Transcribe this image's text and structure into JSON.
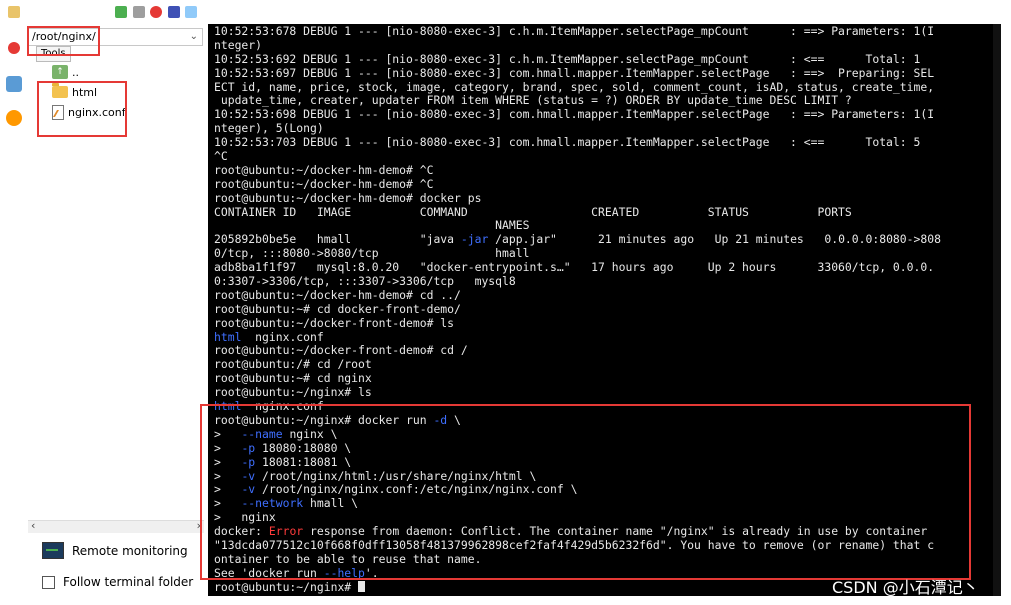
{
  "file_panel": {
    "path": "/root/nginx/",
    "tooltip": "Tools",
    "tree": [
      {
        "name": "..",
        "icon": "up-folder-icon"
      },
      {
        "name": "html",
        "icon": "folder-icon"
      },
      {
        "name": "nginx.conf",
        "icon": "file-icon"
      }
    ],
    "remote_monitoring": "Remote monitoring",
    "follow_terminal_folder": "Follow terminal folder"
  },
  "terminal": {
    "lines": [
      [
        {
          "t": "10:52:53:678 DEBUG 1 --- [nio-8080-exec-3] c.h.m.ItemMapper.selectPage_mpCount      : ==> Parameters: 1(I"
        }
      ],
      [
        {
          "t": "nteger)"
        }
      ],
      [
        {
          "t": "10:52:53:692 DEBUG 1 --- [nio-8080-exec-3] c.h.m.ItemMapper.selectPage_mpCount      : <==      Total: 1"
        }
      ],
      [
        {
          "t": "10:52:53:697 DEBUG 1 --- [nio-8080-exec-3] com.hmall.mapper.ItemMapper.selectPage   : ==>  Preparing: SEL"
        }
      ],
      [
        {
          "t": "ECT id, name, price, stock, image, category, brand, spec, sold, comment_count, isAD, status, create_time,"
        }
      ],
      [
        {
          "t": " update_time, creater, updater FROM item WHERE (status = ?) ORDER BY update_time DESC LIMIT ?"
        }
      ],
      [
        {
          "t": "10:52:53:698 DEBUG 1 --- [nio-8080-exec-3] com.hmall.mapper.ItemMapper.selectPage   : ==> Parameters: 1(I"
        }
      ],
      [
        {
          "t": "nteger), 5(Long)"
        }
      ],
      [
        {
          "t": "10:52:53:703 DEBUG 1 --- [nio-8080-exec-3] com.hmall.mapper.ItemMapper.selectPage   : <==      Total: 5"
        }
      ],
      [
        {
          "t": "^C"
        }
      ],
      [
        {
          "t": "root@ubuntu:~/docker-hm-demo# ^C"
        }
      ],
      [
        {
          "t": "root@ubuntu:~/docker-hm-demo# ^C"
        }
      ],
      [
        {
          "t": "root@ubuntu:~/docker-hm-demo# docker ps"
        }
      ],
      [
        {
          "t": "CONTAINER ID   IMAGE          COMMAND                  CREATED          STATUS          PORTS"
        }
      ],
      [
        {
          "t": "                                         NAMES"
        }
      ],
      [
        {
          "t": "205892b0be5e   hmall          \"java "
        },
        {
          "t": "-jar",
          "c": "blue"
        },
        {
          "t": " /app.jar\"      21 minutes ago   Up 21 minutes   0.0.0.0:8080->808"
        }
      ],
      [
        {
          "t": "0/tcp, :::8080->8080/tcp                 hmall"
        }
      ],
      [
        {
          "t": "adb8ba1f1f97   mysql:8.0.20   \"docker-entrypoint.s…\"   17 hours ago     Up 2 hours      33060/tcp, 0.0.0."
        }
      ],
      [
        {
          "t": "0:3307->3306/tcp, :::3307->3306/tcp   mysql8"
        }
      ],
      [
        {
          "t": "root@ubuntu:~/docker-hm-demo# cd ../"
        }
      ],
      [
        {
          "t": "root@ubuntu:~# cd docker-front-demo/"
        }
      ],
      [
        {
          "t": "root@ubuntu:~/docker-front-demo# ls"
        }
      ],
      [
        {
          "t": "html",
          "c": "blue"
        },
        {
          "t": "  nginx.conf"
        }
      ],
      [
        {
          "t": "root@ubuntu:~/docker-front-demo# cd /"
        }
      ],
      [
        {
          "t": "root@ubuntu:/# cd /root"
        }
      ],
      [
        {
          "t": "root@ubuntu:~# cd nginx"
        }
      ],
      [
        {
          "t": "root@ubuntu:~/nginx# ls"
        }
      ],
      [
        {
          "t": "html",
          "c": "blue"
        },
        {
          "t": "  nginx.conf"
        }
      ],
      [
        {
          "t": "root@ubuntu:~/nginx# docker run "
        },
        {
          "t": "-d",
          "c": "blue"
        },
        {
          "t": " \\"
        }
      ],
      [
        {
          "t": ">   "
        },
        {
          "t": "--name",
          "c": "blue"
        },
        {
          "t": " nginx \\"
        }
      ],
      [
        {
          "t": ">   "
        },
        {
          "t": "-p",
          "c": "blue"
        },
        {
          "t": " 18080:18080 \\"
        }
      ],
      [
        {
          "t": ">   "
        },
        {
          "t": "-p",
          "c": "blue"
        },
        {
          "t": " 18081:18081 \\"
        }
      ],
      [
        {
          "t": ">   "
        },
        {
          "t": "-v",
          "c": "blue"
        },
        {
          "t": " /root/nginx/html:/usr/share/nginx/html \\"
        }
      ],
      [
        {
          "t": ">   "
        },
        {
          "t": "-v",
          "c": "blue"
        },
        {
          "t": " /root/nginx/nginx.conf:/etc/nginx/nginx.conf \\"
        }
      ],
      [
        {
          "t": ">   "
        },
        {
          "t": "--network",
          "c": "blue"
        },
        {
          "t": " hmall \\"
        }
      ],
      [
        {
          "t": ">   nginx"
        }
      ],
      [
        {
          "t": "docker: "
        },
        {
          "t": "Error",
          "c": "red"
        },
        {
          "t": " response from daemon: Conflict. The container name \"/nginx\" is already in use by container"
        }
      ],
      [
        {
          "t": "\"13dcda077512c10f668f0dff13058f481379962898cef2faf4f429d5b6232f6d\". You have to remove (or rename) that c"
        }
      ],
      [
        {
          "t": "ontainer to be able to reuse that name."
        }
      ],
      [
        {
          "t": "See 'docker run "
        },
        {
          "t": "--help",
          "c": "blue"
        },
        {
          "t": "'."
        }
      ],
      [
        {
          "t": "root@ubuntu:~/nginx# "
        }
      ]
    ]
  },
  "watermark": "CSDN @小石潭记丶",
  "colors": {
    "highlight_box": "#e53935",
    "terminal_bg": "#000000",
    "option_blue": "#3f6fff",
    "error_red": "#ff3b3b"
  }
}
